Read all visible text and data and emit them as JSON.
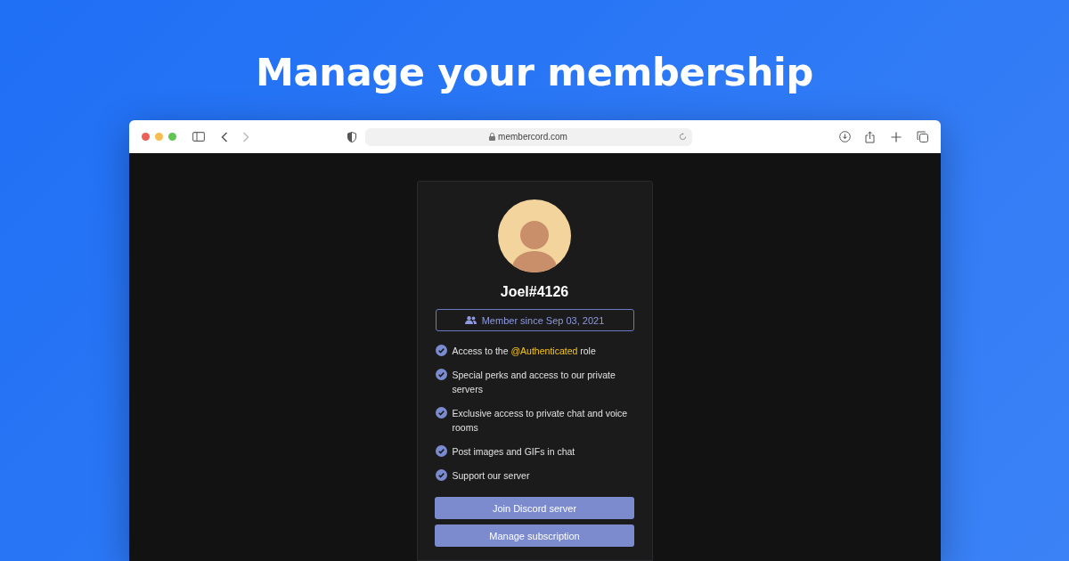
{
  "headline": "Manage your membership",
  "browser": {
    "url": "membercord.com"
  },
  "profile": {
    "name": "Joel#4126",
    "member_since": "Member since Sep 03, 2021"
  },
  "perks": [
    {
      "parts": [
        {
          "kind": "plain",
          "text": "Access to the "
        },
        {
          "kind": "role",
          "text": "@Authenticated"
        },
        {
          "kind": "plain",
          "text": " role"
        }
      ]
    },
    {
      "parts": [
        {
          "kind": "plain",
          "text": "Special perks and access to our private servers"
        }
      ]
    },
    {
      "parts": [
        {
          "kind": "plain",
          "text": "Exclusive access to private chat and voice rooms"
        }
      ]
    },
    {
      "parts": [
        {
          "kind": "plain",
          "text": "Post images and GIFs in chat"
        }
      ]
    },
    {
      "parts": [
        {
          "kind": "plain",
          "text": "Support our server"
        }
      ]
    }
  ],
  "buttons": [
    "Join Discord server",
    "Manage subscription"
  ]
}
